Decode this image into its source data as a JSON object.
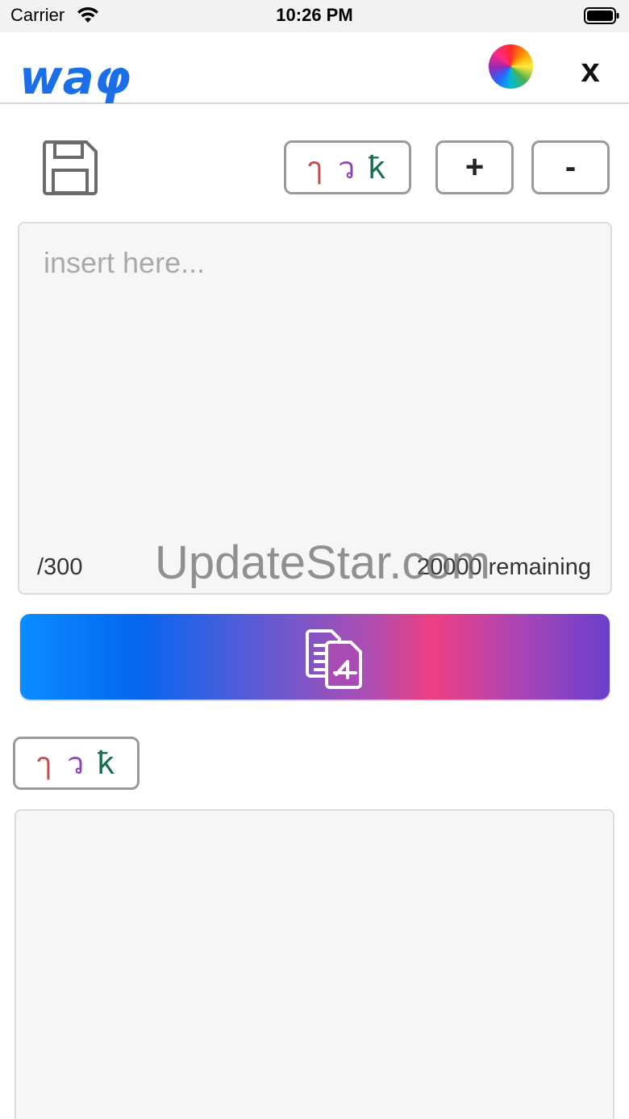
{
  "status_bar": {
    "carrier": "Carrier",
    "time": "10:26 PM"
  },
  "header": {
    "logo_text": "wаφ",
    "close_label": "x"
  },
  "toolbar": {
    "script_toggle_glyphs": [
      "ๅ",
      "ว",
      "ҟ"
    ],
    "plus_label": "+",
    "minus_label": "-"
  },
  "input": {
    "placeholder": "insert here...",
    "counter_left": "/300",
    "counter_right": "20000 remaining"
  },
  "watermark": "UpdateStar.com",
  "output": {
    "script_glyphs": [
      "ๅ",
      "ว",
      "ҟ"
    ]
  },
  "colors": {
    "logo_blue": "#1a6ee8",
    "glyph_red": "#c0504d",
    "glyph_purple": "#8e44ad",
    "glyph_green": "#1b6b4f"
  },
  "icons": {
    "save": "floppy-disk-icon",
    "palette": "color-wheel-icon",
    "convert": "transliterate-documents-icon"
  }
}
